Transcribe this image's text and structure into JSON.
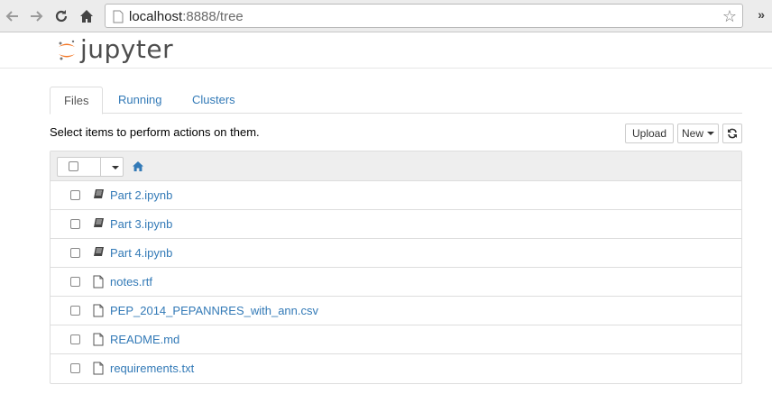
{
  "browser": {
    "url_host": "localhost",
    "url_path": ":8888/tree",
    "more_glyph": "»"
  },
  "app": {
    "logo_text": "jupyter"
  },
  "tabs": [
    {
      "label": "Files",
      "active": true
    },
    {
      "label": "Running",
      "active": false
    },
    {
      "label": "Clusters",
      "active": false
    }
  ],
  "toolbar": {
    "hint": "Select items to perform actions on them.",
    "upload_label": "Upload",
    "new_label": "New"
  },
  "files": [
    {
      "name": "Part 2.ipynb",
      "icon": "notebook-icon"
    },
    {
      "name": "Part 3.ipynb",
      "icon": "notebook-icon"
    },
    {
      "name": "Part 4.ipynb",
      "icon": "notebook-icon"
    },
    {
      "name": "notes.rtf",
      "icon": "file-icon"
    },
    {
      "name": "PEP_2014_PEPANNRES_with_ann.csv",
      "icon": "file-icon"
    },
    {
      "name": "README.md",
      "icon": "file-icon"
    },
    {
      "name": "requirements.txt",
      "icon": "file-icon"
    }
  ],
  "colors": {
    "link": "#337ab7",
    "logo_orange": "#f37726"
  }
}
